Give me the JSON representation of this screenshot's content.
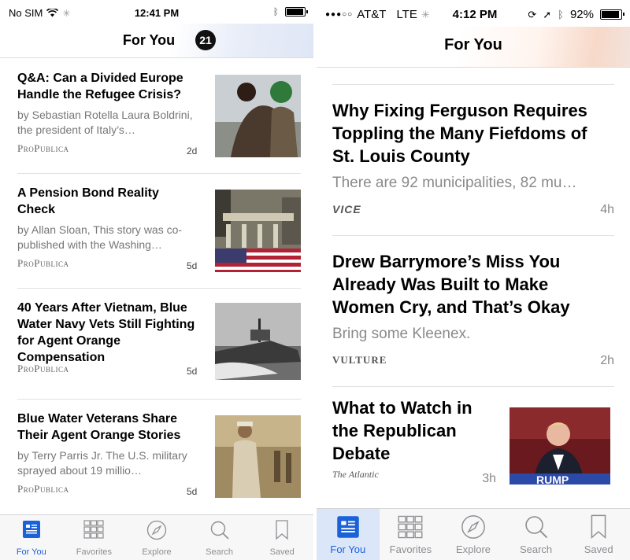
{
  "left": {
    "status": {
      "carrier": "No SIM",
      "time": "12:41 PM"
    },
    "nav": {
      "title": "For You",
      "badge": "21"
    },
    "stories": [
      {
        "headline": "Q&A: Can a Divided Europe Handle the Refugee Crisis?",
        "excerpt": "by Sebastian Rotella Laura Boldrini, the president of Italy’s…",
        "source": "ProPublica",
        "age": "2d"
      },
      {
        "headline": "A Pension Bond Reality Check",
        "excerpt": "by Allan Sloan, This story was co-published with the Washing…",
        "source": "ProPublica",
        "age": "5d"
      },
      {
        "headline": "40 Years After Vietnam, Blue Water Navy Vets Still Fighting for Agent Orange Compensation",
        "excerpt": "",
        "source": "ProPublica",
        "age": "5d"
      },
      {
        "headline": "Blue Water Veterans Share Their Agent Orange Stories",
        "excerpt": "by Terry Parris Jr. The U.S. military sprayed about 19 millio…",
        "source": "ProPublica",
        "age": "5d"
      }
    ],
    "tabs": [
      "For You",
      "Favorites",
      "Explore",
      "Search",
      "Saved"
    ]
  },
  "right": {
    "status": {
      "carrier": "AT&T",
      "network": "LTE",
      "time": "4:12 PM",
      "battery": "92%"
    },
    "nav": {
      "title": "For You"
    },
    "stories": [
      {
        "headline": "Why Fixing Ferguson Requires Toppling the Many Fiefdoms of St. Louis County",
        "excerpt": "There are 92 municipalities, 82 mu…",
        "source": "VICE",
        "age": "4h"
      },
      {
        "headline": "Drew Barrymore’s Miss You Already Was Built to Make Women Cry, and That’s Okay",
        "excerpt": "Bring some Kleenex.",
        "source": "VULTURE",
        "age": "2h"
      },
      {
        "headline": "What to Watch in the Republican Debate",
        "excerpt": "",
        "source": "The Atlantic",
        "age": "3h"
      }
    ],
    "tabs": [
      "For You",
      "Favorites",
      "Explore",
      "Search",
      "Saved"
    ]
  },
  "colors": {
    "accent": "#1b62d8",
    "tab_inactive": "#8e8e93"
  }
}
